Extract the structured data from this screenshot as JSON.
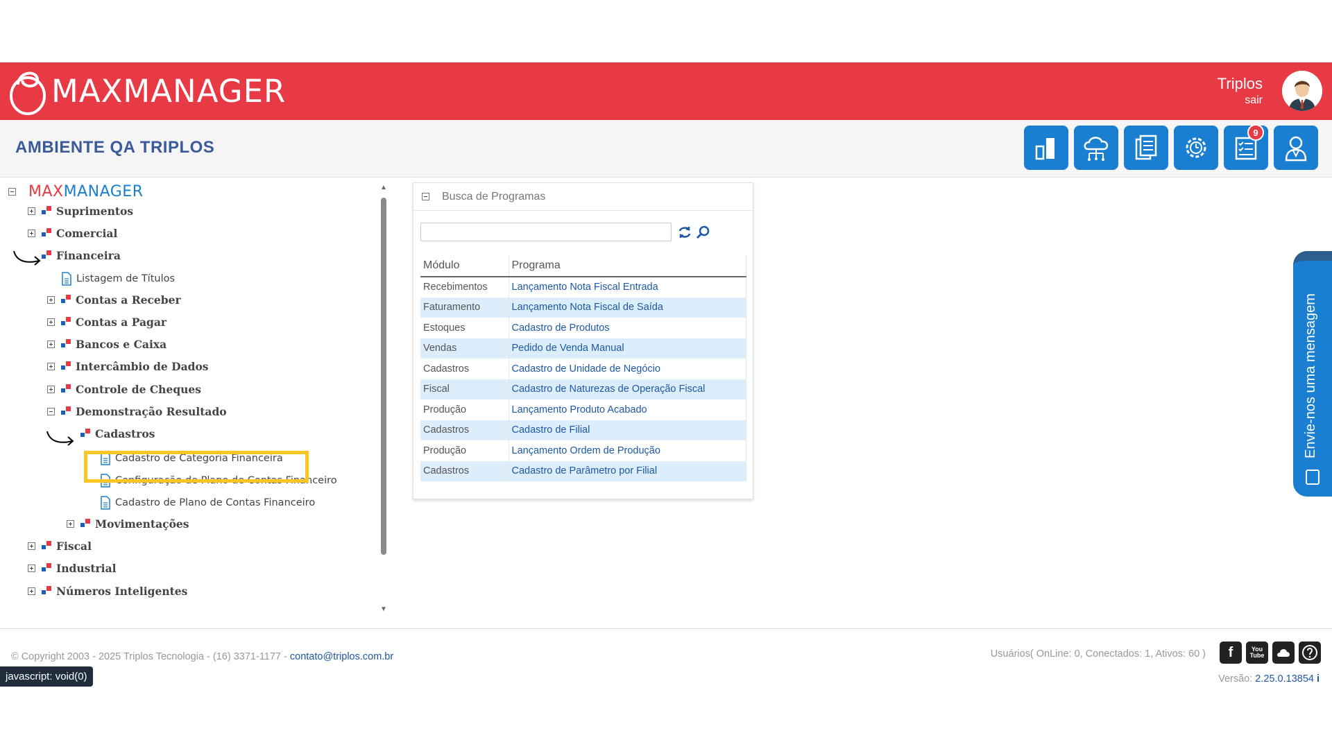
{
  "header": {
    "brand": "MAXMANAGER",
    "user_name": "Triplos",
    "logout": "sair"
  },
  "subheader": {
    "environment_title": "AMBIENTE QA TRIPLOS",
    "notification_count": "9",
    "tools": [
      "bar-chart-icon",
      "cloud-network-icon",
      "documents-icon",
      "gear-clock-icon",
      "checklist-icon",
      "user-support-icon"
    ]
  },
  "tree": {
    "root": {
      "max": "MAX",
      "manager": "MANAGER"
    },
    "nodes": [
      "Suprimentos",
      "Comercial",
      "Financeira",
      "Listagem de Títulos",
      "Contas a Receber",
      "Contas a Pagar",
      "Bancos e Caixa",
      "Intercâmbio de Dados",
      "Controle de Cheques",
      "Demonstração Resultado",
      "Cadastros",
      "Cadastro de Categoria Financeira",
      "Configuração de Plano de Contas Financeiro",
      "Cadastro de Plano de Contas Financeiro",
      "Movimentações",
      "Fiscal",
      "Industrial",
      "Números Inteligentes"
    ]
  },
  "busca": {
    "title": "Busca de Programas",
    "search_value": "",
    "columns": [
      "Módulo",
      "Programa"
    ],
    "rows": [
      {
        "modulo": "Recebimentos",
        "programa": "Lançamento Nota Fiscal Entrada"
      },
      {
        "modulo": "Faturamento",
        "programa": "Lançamento Nota Fiscal de Saída"
      },
      {
        "modulo": "Estoques",
        "programa": "Cadastro de Produtos"
      },
      {
        "modulo": "Vendas",
        "programa": "Pedido de Venda Manual"
      },
      {
        "modulo": "Cadastros",
        "programa": "Cadastro de Unidade de Negócio"
      },
      {
        "modulo": "Fiscal",
        "programa": "Cadastro de Naturezas de Operação Fiscal"
      },
      {
        "modulo": "Produção",
        "programa": "Lançamento Produto Acabado"
      },
      {
        "modulo": "Cadastros",
        "programa": "Cadastro de Filial"
      },
      {
        "modulo": "Produção",
        "programa": "Lançamento Ordem de Produção"
      },
      {
        "modulo": "Cadastros",
        "programa": "Cadastro de Parâmetro por Filial"
      }
    ]
  },
  "side_tab": {
    "label": "Envie-nos uma mensagem"
  },
  "footer": {
    "copyright": "© Copyright 2003 - 2025 Triplos Tecnologia - (16) 3371-1177 - ",
    "email": "contato@triplos.com.br",
    "status_tip": "javascript: void(0)",
    "users_info": "Usuários( OnLine: 0, Conectados: 1, Ativos: 60 )",
    "version_label": "Versão: ",
    "version_number": "2.25.0.13854",
    "info_glyph": "i"
  },
  "colors": {
    "brand_red": "#e73a45",
    "brand_blue": "#1b7fd1",
    "title_blue": "#3a5a9a",
    "highlight": "#f9c623",
    "row_alt": "#dcedfc"
  }
}
